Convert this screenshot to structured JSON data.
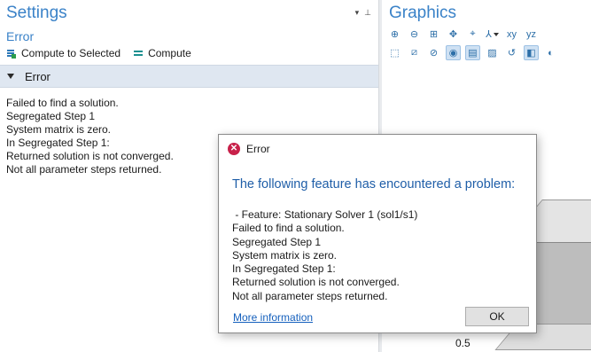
{
  "settings": {
    "title": "Settings",
    "pin_icons": [
      "▾",
      "⊥"
    ],
    "subtitle": "Error",
    "toolbar": {
      "compute_to_selected": "Compute to Selected",
      "compute": "Compute"
    },
    "section_label": "Error",
    "messages": [
      "Failed to find a solution.",
      "Segregated Step 1",
      "System matrix is zero.",
      "In Segregated Step 1:",
      "Returned solution is not converged.",
      "Not all parameter steps returned."
    ]
  },
  "graphics": {
    "title": "Graphics",
    "axis_tick": "0.5",
    "toolbar_icons_row1": [
      "zoom-in-icon",
      "zoom-out-icon",
      "zoom-box-icon",
      "zoom-extents-icon",
      "fit-icon",
      "axis-orientation-icon",
      "xy-view-icon",
      "yz-view-icon"
    ],
    "toolbar_icons_row2": [
      "select-box-icon",
      "deselect-icon",
      "hide-icon",
      "show-icon",
      "wireframe-icon",
      "transparency-icon",
      "reset-icon",
      "render-icon",
      "light-icon"
    ],
    "view_labels": {
      "xy": "xy",
      "yz": "yz"
    }
  },
  "dialog": {
    "title": "Error",
    "heading": "The following feature has encountered a problem:",
    "body": [
      " - Feature: Stationary Solver 1 (sol1/s1)",
      "Failed to find a solution.",
      "Segregated Step 1",
      "System matrix is zero.",
      "In Segregated Step 1:",
      "Returned solution is not converged.",
      "Not all parameter steps returned."
    ],
    "more_info": "More information",
    "ok_label": "OK"
  },
  "colors": {
    "accent_title": "#3a82c8",
    "dialog_heading": "#1f5ea8",
    "error_icon": "#c8214a",
    "section_bar": "#dfe7f1"
  }
}
